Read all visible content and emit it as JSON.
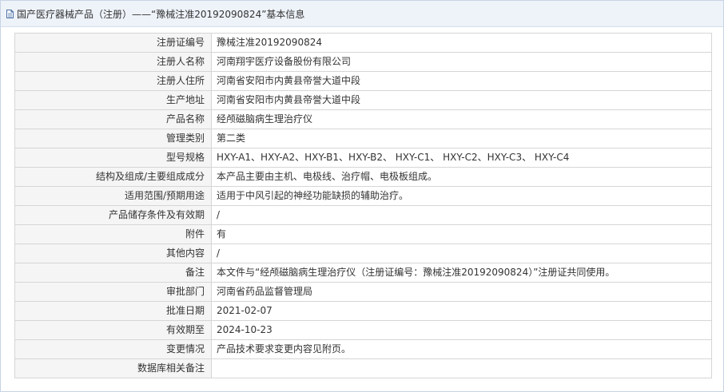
{
  "header": {
    "title": "国产医疗器械产品（注册）——“豫械注准20192090824”基本信息"
  },
  "rows": [
    {
      "label": "注册证编号",
      "value": "豫械注准20192090824"
    },
    {
      "label": "注册人名称",
      "value": "河南翔宇医疗设备股份有限公司"
    },
    {
      "label": "注册人住所",
      "value": "河南省安阳市内黄县帝誉大道中段"
    },
    {
      "label": "生产地址",
      "value": "河南省安阳市内黄县帝誉大道中段"
    },
    {
      "label": "产品名称",
      "value": "经颅磁脑病生理治疗仪"
    },
    {
      "label": "管理类别",
      "value": "第二类"
    },
    {
      "label": "型号规格",
      "value": "HXY-A1、HXY-A2、HXY-B1、HXY-B2、 HXY-C1、 HXY-C2、HXY-C3、 HXY-C4"
    },
    {
      "label": "结构及组成/主要组成成分",
      "value": "本产品主要由主机、电极线、治疗帽、电极板组成。"
    },
    {
      "label": "适用范围/预期用途",
      "value": "适用于中风引起的神经功能缺损的辅助治疗。"
    },
    {
      "label": "产品储存条件及有效期",
      "value": "/"
    },
    {
      "label": "附件",
      "value": "有"
    },
    {
      "label": "其他内容",
      "value": "/"
    },
    {
      "label": "备注",
      "value": "本文件与“经颅磁脑病生理治疗仪（注册证编号：豫械注准20192090824）”注册证共同使用。"
    },
    {
      "label": "审批部门",
      "value": "河南省药品监督管理局"
    },
    {
      "label": "批准日期",
      "value": "2021-02-07"
    },
    {
      "label": "有效期至",
      "value": "2024-10-23"
    },
    {
      "label": "变更情况",
      "value": "产品技术要求变更内容见附页。"
    },
    {
      "label": "数据库相关备注",
      "value": ""
    }
  ]
}
